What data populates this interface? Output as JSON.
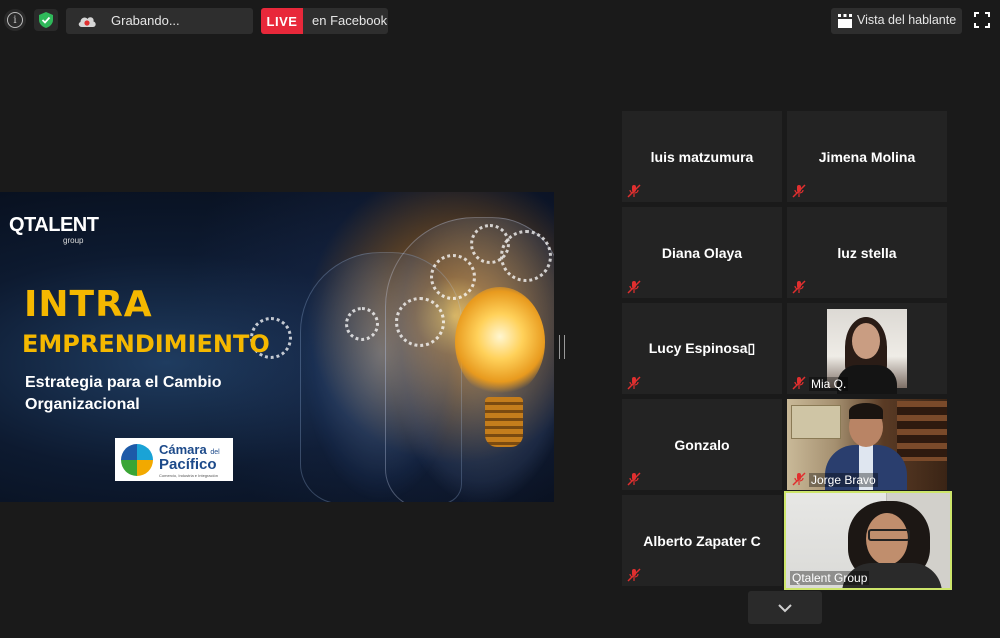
{
  "toolbar": {
    "recording_label": "Grabando...",
    "live_label": "LIVE",
    "live_target": "en Facebook",
    "speaker_view_label": "Vista del hablante",
    "icons": [
      "info-icon",
      "shield-icon",
      "cloud-record-icon",
      "pause-icon",
      "stop-icon",
      "speaker-view-icon",
      "fullscreen-icon"
    ]
  },
  "shared_screen": {
    "brand": "QTALENT",
    "brand_sub": "group",
    "title_line1": "INTRA",
    "title_line2": "EMPRENDIMIENTO",
    "subtitle_line1": "Estrategia para el Cambio",
    "subtitle_line2": "Organizacional",
    "sponsor_name_1": "Cámara",
    "sponsor_name_1_small": "del",
    "sponsor_name_2": "Pacífico",
    "sponsor_tagline": "Comercio, Industria e Integración"
  },
  "gallery": {
    "tiles": [
      {
        "name": "luis matzumura",
        "muted": true,
        "video": false
      },
      {
        "name": "Jimena Molina",
        "muted": true,
        "video": false
      },
      {
        "name": "Diana Olaya",
        "muted": true,
        "video": false
      },
      {
        "name": "luz stella",
        "muted": true,
        "video": false
      },
      {
        "name": "Lucy  Espinosa▯",
        "muted": true,
        "video": false
      },
      {
        "name": "Mia Q.",
        "muted": true,
        "video": true
      },
      {
        "name": "Gonzalo",
        "muted": true,
        "video": false
      },
      {
        "name": "Jorge Bravo",
        "muted": true,
        "video": true
      },
      {
        "name": "Alberto Zapater C",
        "muted": true,
        "video": false
      },
      {
        "name": "Qtalent Group",
        "muted": false,
        "video": true,
        "active_speaker": true
      }
    ]
  },
  "colors": {
    "live_red": "#e8283a",
    "active_speaker_border": "#cde56b",
    "mute_red": "#e02f2f",
    "title_yellow": "#f5b800"
  }
}
